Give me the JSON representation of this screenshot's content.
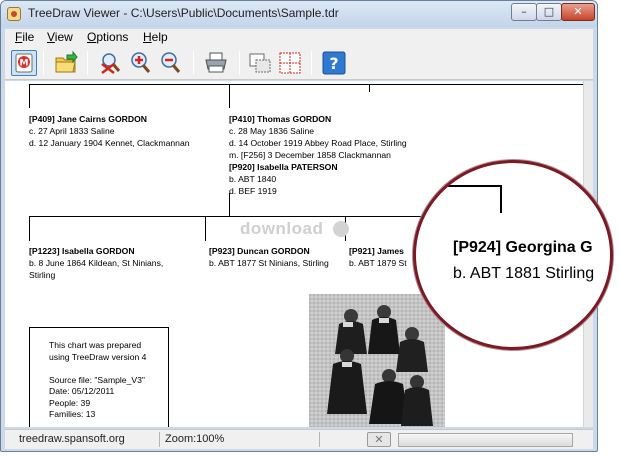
{
  "window": {
    "title": "TreeDraw Viewer - C:\\Users\\Public\\Documents\\Sample.tdr",
    "minimize_glyph": "–",
    "maximize_glyph": "□",
    "close_glyph": "✕"
  },
  "menu": [
    {
      "accel": "F",
      "rest": "ile"
    },
    {
      "accel": "V",
      "rest": "iew"
    },
    {
      "accel": "O",
      "rest": "ptions"
    },
    {
      "accel": "H",
      "rest": "elp"
    }
  ],
  "toolbar": {
    "icons": [
      "mode-icon",
      "open-folder-icon",
      "zoom-fit-icon",
      "zoom-in-icon",
      "zoom-out-icon",
      "print-icon",
      "page-select-icon",
      "page-grid-icon",
      "help-icon"
    ],
    "help_glyph": "?"
  },
  "tree": {
    "persons": [
      {
        "lines": [
          {
            "text": "[P409] Jane Cairns GORDON",
            "bold": true
          },
          {
            "text": "c. 27 April 1833 Saline"
          },
          {
            "text": "d. 12 January 1904 Kennet, Clackmannan"
          }
        ]
      },
      {
        "lines": [
          {
            "text": "[P410] Thomas GORDON",
            "bold": true
          },
          {
            "text": "c. 28 May 1836 Saline"
          },
          {
            "text": "d. 14 October 1919 Abbey Road Place, Stirling"
          },
          {
            "text": "m. [F256] 3 December 1858 Clackmannan"
          },
          {
            "text": "[P920] Isabella PATERSON",
            "bold": true
          },
          {
            "text": "b. ABT 1840"
          },
          {
            "text": "d. BEF 1919"
          }
        ]
      },
      {
        "lines": [
          {
            "text": "[P1223] Isabella GORDON",
            "bold": true
          },
          {
            "text": "b. 8 June 1864 Kildean, St Ninians,"
          },
          {
            "text": "Stirling"
          }
        ]
      },
      {
        "lines": [
          {
            "text": "[P923] Duncan GORDON",
            "bold": true
          },
          {
            "text": "b. ABT 1877 St Ninians, Stirling"
          }
        ]
      },
      {
        "lines": [
          {
            "text": "[P921] James",
            "bold": true
          },
          {
            "text": "b. ABT 1879 St"
          }
        ]
      }
    ],
    "info_box": [
      "This chart was prepared",
      "using TreeDraw version 4",
      "",
      "Source file: \"Sample_V3\"",
      "Date: 05/12/2011",
      "People: 39",
      "Families: 13"
    ]
  },
  "watermark": "download",
  "magnifier": {
    "name": "[P924] Georgina G",
    "birth": "b. ABT 1881 Stirling"
  },
  "status": {
    "url": "treedraw.spansoft.org",
    "zoom": "Zoom:100%",
    "cancel_glyph": "✕"
  }
}
